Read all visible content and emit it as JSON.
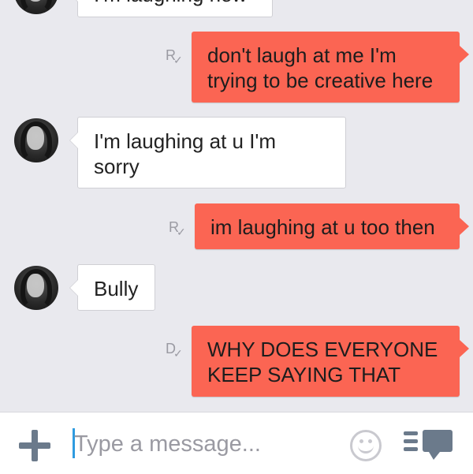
{
  "messages": [
    {
      "direction": "in",
      "text": "I'm laughing now"
    },
    {
      "direction": "out",
      "status": "R",
      "text": "don't laugh at me I'm\ntrying to be creative here"
    },
    {
      "direction": "in",
      "text": "I'm laughing at u I'm\nsorry"
    },
    {
      "direction": "out",
      "status": "R",
      "text": "im laughing at u too then"
    },
    {
      "direction": "in",
      "text": "Bully"
    },
    {
      "direction": "out",
      "status": "D",
      "text": "WHY DOES EVERYONE\nKEEP SAYING THAT"
    }
  ],
  "composer": {
    "placeholder": "Type a message...",
    "value": ""
  },
  "icons": {
    "add": "plus-icon",
    "emoji": "smiley-icon",
    "stickers": "sticker-list-icon",
    "status_check": "check-icon"
  },
  "colors": {
    "outgoing_bubble": "#fb6553",
    "incoming_bubble": "#ffffff",
    "background": "#e9e9ee",
    "cursor": "#2e9be0"
  }
}
